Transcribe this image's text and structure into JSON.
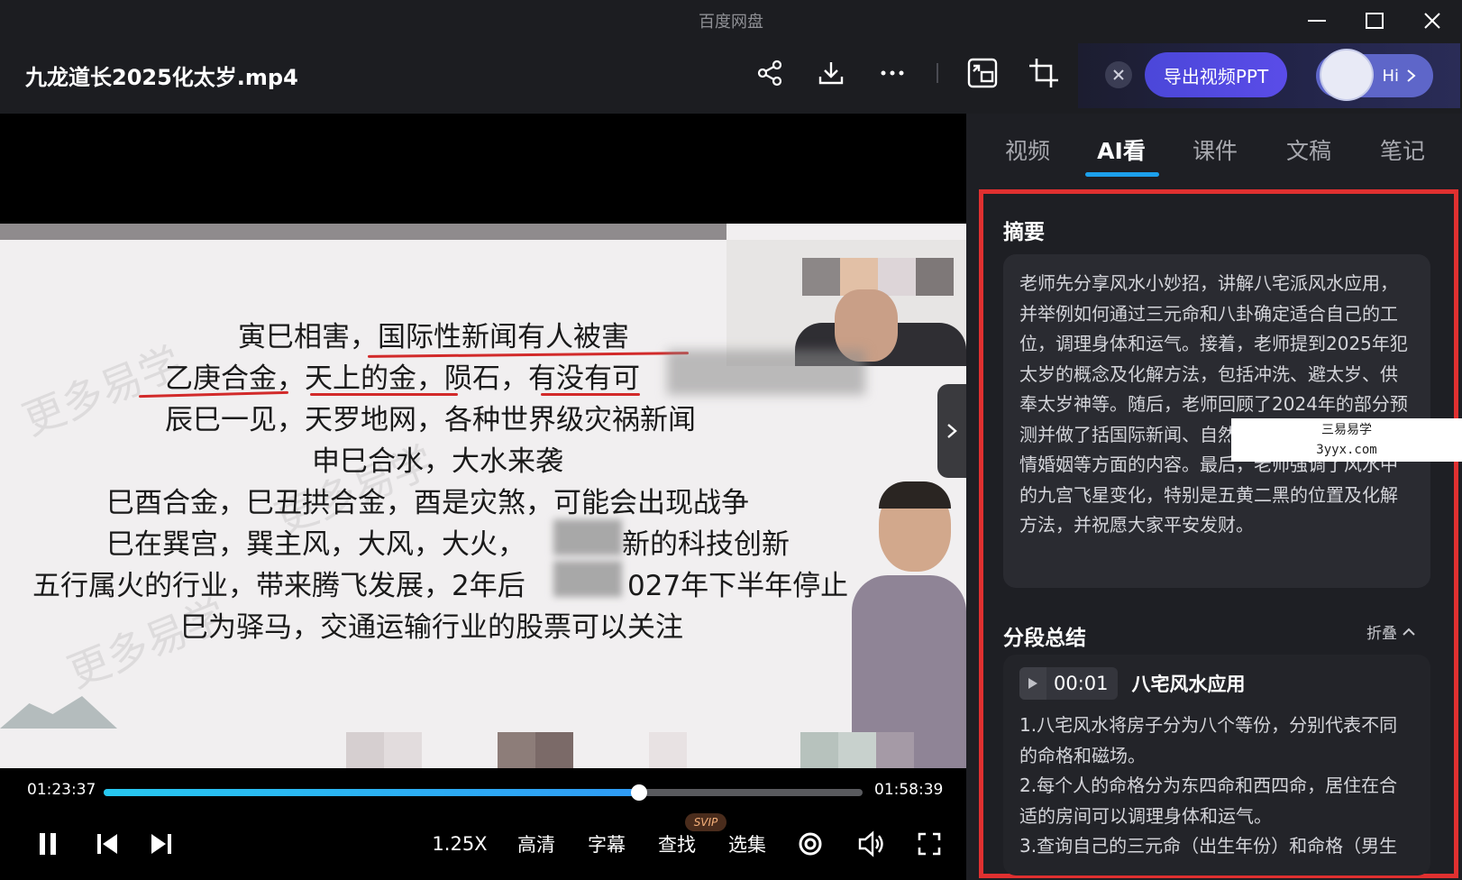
{
  "app": {
    "title": "百度网盘"
  },
  "window_controls": {
    "minimize": "minimize-icon",
    "maximize": "maximize-icon",
    "close": "close-icon"
  },
  "file": {
    "name": "九龙道长2025化太岁.mp4"
  },
  "toolbar": {
    "icons": [
      "share-icon",
      "download-icon",
      "more-icon",
      "screenshot-icon",
      "crop-icon"
    ]
  },
  "promo": {
    "export_button": "导出视频PPT",
    "assistant_label": "Hi"
  },
  "slide": {
    "lines": [
      "寅巳相害，国际性新闻有人被害",
      "乙庚合金，天上的金，陨石，有没有可",
      "辰巳一见，天罗地网，各种世界级灾祸新闻",
      "申巳合水，大水来袭",
      "巳酉合金，巳丑拱合金，酉是灾煞，可能会出现战争",
      "巳在巽宫，巽主风，大风，大火，",
      "新的科技创新",
      "五行属火的行业，带来腾飞发展，2年后",
      "027年下半年停止",
      "巳为驿马，交通运输行业的股票可以关注"
    ],
    "watermark": "更多易学"
  },
  "player": {
    "current_time": "01:23:37",
    "total_time": "01:58:39",
    "progress": 0.705,
    "speed": "1.25X",
    "quality": "高清",
    "subtitle": "字幕",
    "search": "查找",
    "svip_badge": "SVIP",
    "episodes": "选集"
  },
  "panel": {
    "tabs": [
      "视频",
      "AI看",
      "课件",
      "文稿",
      "笔记"
    ],
    "active_tab": "AI看",
    "summary": {
      "title": "摘要",
      "text": "老师先分享风水小妙招，讲解八宅派风水应用，并举例如何通过三元命和八卦确定适合自己的工位，调理身体和运气。接着，老师提到2025年犯太岁的概念及化解方法，包括冲洗、避太岁、供奉太岁神等。随后，老师回顾了2024年的部分预测并做了括国际新闻、自然灾害、金融走势及感情婚姻等方面的内容。最后，老师强调了风水中的九宫飞星变化，特别是五黄二黑的位置及化解方法，并祝愿大家平安发财。"
    },
    "segments": {
      "title": "分段总结",
      "collapse_label": "折叠",
      "items": [
        {
          "time": "00:01",
          "title": "八宅风水应用",
          "points": [
            "1.八宅风水将房子分为八个等份，分别代表不同的命格和磁场。",
            "2.每个人的命格分为东四命和西四命，居住在合适的房间可以调理身体和运气。",
            "3.查询自己的三元命（出生年份）和命格（男生"
          ]
        }
      ]
    }
  },
  "site_watermark": {
    "line1": "三易易学",
    "line2": "3yyx.com"
  }
}
